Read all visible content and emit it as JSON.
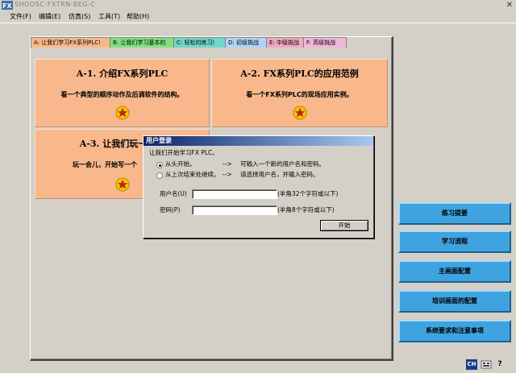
{
  "window": {
    "title": "SHOOSC-FXTRN-BEG-C",
    "close_glyph": "✕"
  },
  "menu": {
    "items": [
      "文件(F)",
      "编辑(E)",
      "仿真(S)",
      "工具(T)",
      "帮助(H)"
    ]
  },
  "tabs": [
    {
      "label": "A: 让我们学习FX系列PLC!",
      "color": "#f8b88c"
    },
    {
      "label": "B: 让我们学习基本的",
      "color": "#80e080"
    },
    {
      "label": "C: 轻松的练习!",
      "color": "#70d8c8"
    },
    {
      "label": "D: 初级挑战",
      "color": "#b0d4f8"
    },
    {
      "label": "E: 中级挑战",
      "color": "#f0a8c0"
    },
    {
      "label": "F: 高级挑战",
      "color": "#f0b8d8"
    }
  ],
  "cards": [
    {
      "title": "A-1. 介绍FX系列PLC",
      "desc": "看一个典型的顺序动作及后调软件的结构。"
    },
    {
      "title": "A-2. FX系列PLC的应用范例",
      "desc": "看一个FX系列PLC的现场应用实例。"
    },
    {
      "title": "A-3. 让我们玩一会儿",
      "desc": "玩一会儿，开始写一个"
    }
  ],
  "dialog": {
    "title": "用户登录",
    "intro": "让我们开始学习FX PLC。",
    "option1": {
      "label": "从头开始。",
      "arrow": "-->",
      "hint": "可输入一个新的用户名和密码。",
      "checked": true
    },
    "option2": {
      "label": "从上次结束处继续。",
      "arrow": "-->",
      "hint": "请选择用户名，并输入密码。",
      "checked": false
    },
    "username_label": "用户名(U)",
    "username_value": "",
    "username_hint": "(半角32个字符或以下)",
    "password_label": "密码(P)",
    "password_value": "",
    "password_hint": "(半角8个字符或以下)",
    "start_button": "开始"
  },
  "side_buttons": [
    "练习提要",
    "学习流程",
    "主画面配置",
    "培训画面的配置",
    "系统要求和注意事项"
  ],
  "tray": {
    "ime": "CH",
    "help": "?"
  },
  "colors": {
    "card": "#f8b88c",
    "side_button": "#3fa3e0",
    "dialog_title": "#0a246a"
  }
}
